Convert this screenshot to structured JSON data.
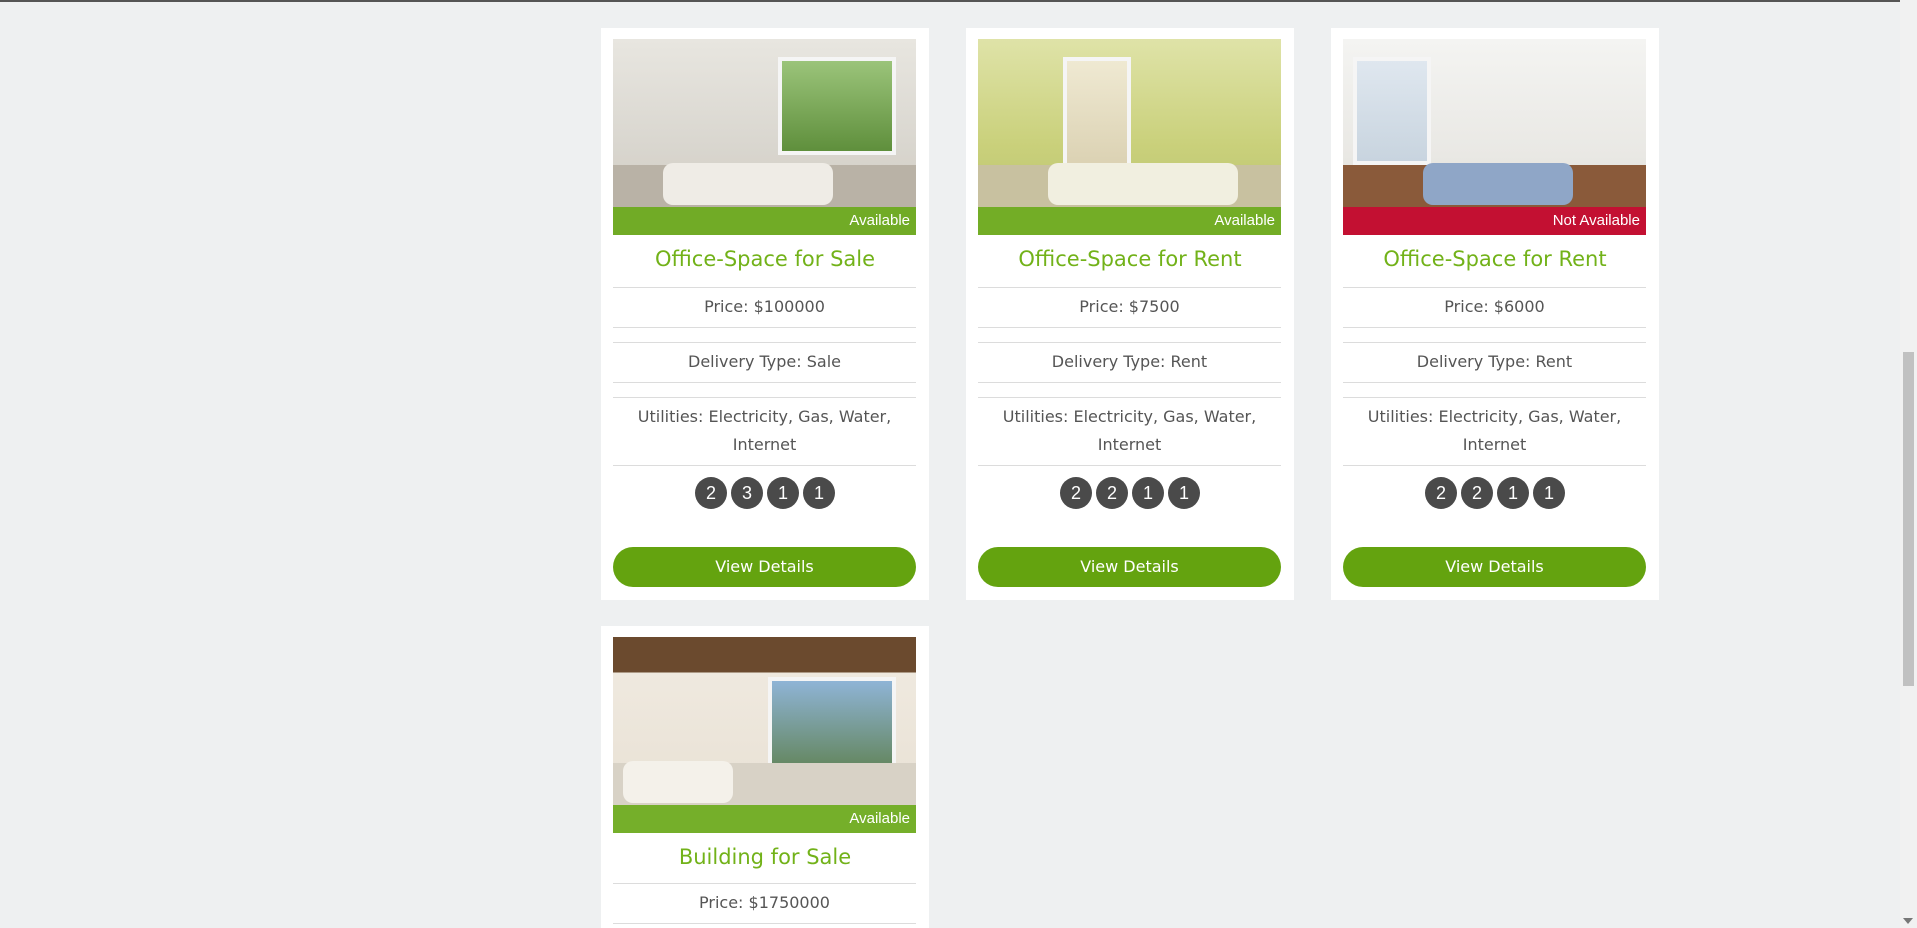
{
  "cards": [
    {
      "status": "Available",
      "title": "Office-Space for Sale",
      "price": "Price: $100000",
      "delivery": "Delivery Type: Sale",
      "utilities_line1": "Utilities: Electricity, Gas, Water,",
      "utilities_line2": "Internet",
      "badges": [
        "2",
        "3",
        "1",
        "1"
      ],
      "button": "View Details"
    },
    {
      "status": "Available",
      "title": "Office-Space for Rent",
      "price": "Price: $7500",
      "delivery": "Delivery Type: Rent",
      "utilities_line1": "Utilities: Electricity, Gas, Water,",
      "utilities_line2": "Internet",
      "badges": [
        "2",
        "2",
        "1",
        "1"
      ],
      "button": "View Details"
    },
    {
      "status": "Not Available",
      "title": "Office-Space for Rent",
      "price": "Price: $6000",
      "delivery": "Delivery Type: Rent",
      "utilities_line1": "Utilities: Electricity, Gas, Water,",
      "utilities_line2": "Internet",
      "badges": [
        "2",
        "2",
        "1",
        "1"
      ],
      "button": "View Details"
    },
    {
      "status": "Available",
      "title": "Building for Sale",
      "price": "Price: $1750000"
    }
  ],
  "colors": {
    "title_green": "#72b219",
    "button_green": "#64a30f",
    "available_overlay": "#66aa14",
    "not_available_overlay": "#c80a32"
  }
}
